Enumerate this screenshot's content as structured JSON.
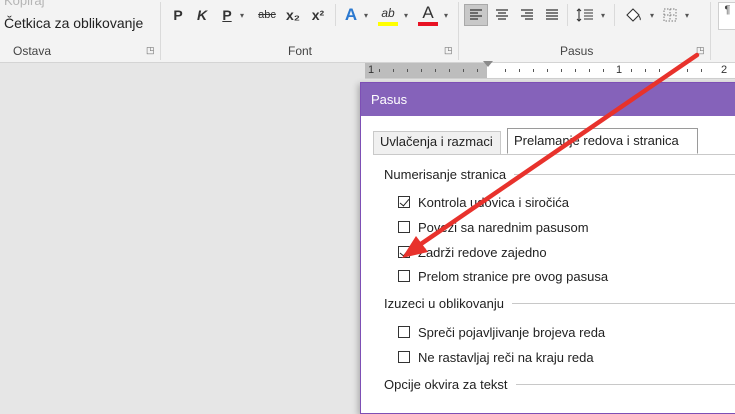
{
  "ribbon": {
    "clipboard": {
      "faded_text": "Kopiraj",
      "format_painter": "Četkica za oblikovanje",
      "group_label": "Ostava"
    },
    "font": {
      "bold": "P",
      "italic": "K",
      "underline": "P",
      "strikethrough": "abc",
      "subscript": "x₂",
      "superscript": "x²",
      "text_effects": "A",
      "highlight": "ab",
      "font_color": "A",
      "group_label": "Font"
    },
    "paragraph": {
      "group_label": "Pasus"
    },
    "styles_partial": "¶"
  },
  "ruler": {
    "labels": [
      "1",
      "1",
      "2"
    ]
  },
  "dialog": {
    "title": "Pasus",
    "tabs": [
      {
        "label": "Uvlačenja i razmaci",
        "active": false
      },
      {
        "label": "Prelamanje redova i stranica",
        "active": true
      }
    ],
    "sections": [
      {
        "title": "Numerisanje stranica",
        "options": [
          {
            "label": "Kontrola udovica i siročića",
            "checked": true
          },
          {
            "label": "Poveži sa narednim pasusom",
            "checked": false
          },
          {
            "label": "Zadrži redove zajedno",
            "checked": true
          },
          {
            "label": "Prelom stranice pre ovog pasusa",
            "checked": false
          }
        ]
      },
      {
        "title": "Izuzeci u oblikovanju",
        "options": [
          {
            "label": "Spreči pojavljivanje brojeva reda",
            "checked": false
          },
          {
            "label": "Ne rastavljaj reči na kraju reda",
            "checked": false
          }
        ]
      },
      {
        "title": "Opcije okvira za tekst",
        "options": []
      }
    ]
  },
  "colors": {
    "dialog_title_bar": "#8562ba",
    "arrow": "#e8322c",
    "highlight_yellow": "#ffff00",
    "font_red": "#e81123",
    "effects_blue": "#2b79d0"
  }
}
